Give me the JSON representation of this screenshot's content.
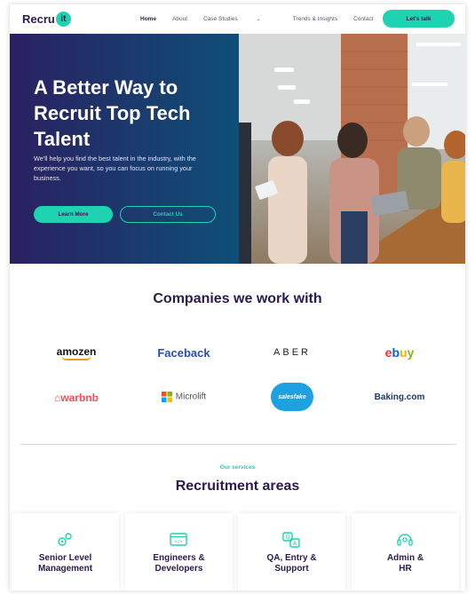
{
  "header": {
    "logo_text": "Recru",
    "logo_badge": "it",
    "nav": [
      {
        "label": "Home",
        "active": true
      },
      {
        "label": "About"
      },
      {
        "label": "Case Studies",
        "has_dropdown": true
      },
      {
        "label": "Trends & Insights"
      },
      {
        "label": "Contact"
      }
    ],
    "cta_label": "Let's talk"
  },
  "hero": {
    "title": "A Better Way to Recruit Top Tech Talent",
    "text": "We'll help you find the best talent in the industry, with the experience you want, so you can focus on running your business.",
    "primary_button": "Learn More",
    "secondary_button": "Contact Us"
  },
  "companies": {
    "title": "Companies we work with",
    "logos": [
      "amozen",
      "Faceback",
      "ABER",
      "ebuy",
      "warbnb",
      "Microlift",
      "salesfake",
      "Baking.com"
    ]
  },
  "services": {
    "tag": "Our services",
    "title": "Recruitment areas",
    "cards": [
      {
        "label": "Senior Level\nManagement",
        "icon": "gears-icon"
      },
      {
        "label": "Engineers &\nDevelopers",
        "icon": "browser-code-icon"
      },
      {
        "label": "QA, Entry &\nSupport",
        "icon": "qa-chat-icon"
      },
      {
        "label": "Admin &\nHR",
        "icon": "headset-icon"
      }
    ]
  },
  "colors": {
    "accent": "#1dd3b0",
    "brand_dark": "#2b1a4f",
    "hero_gradient_start": "#2a2060",
    "hero_gradient_end": "#0f4f77"
  }
}
